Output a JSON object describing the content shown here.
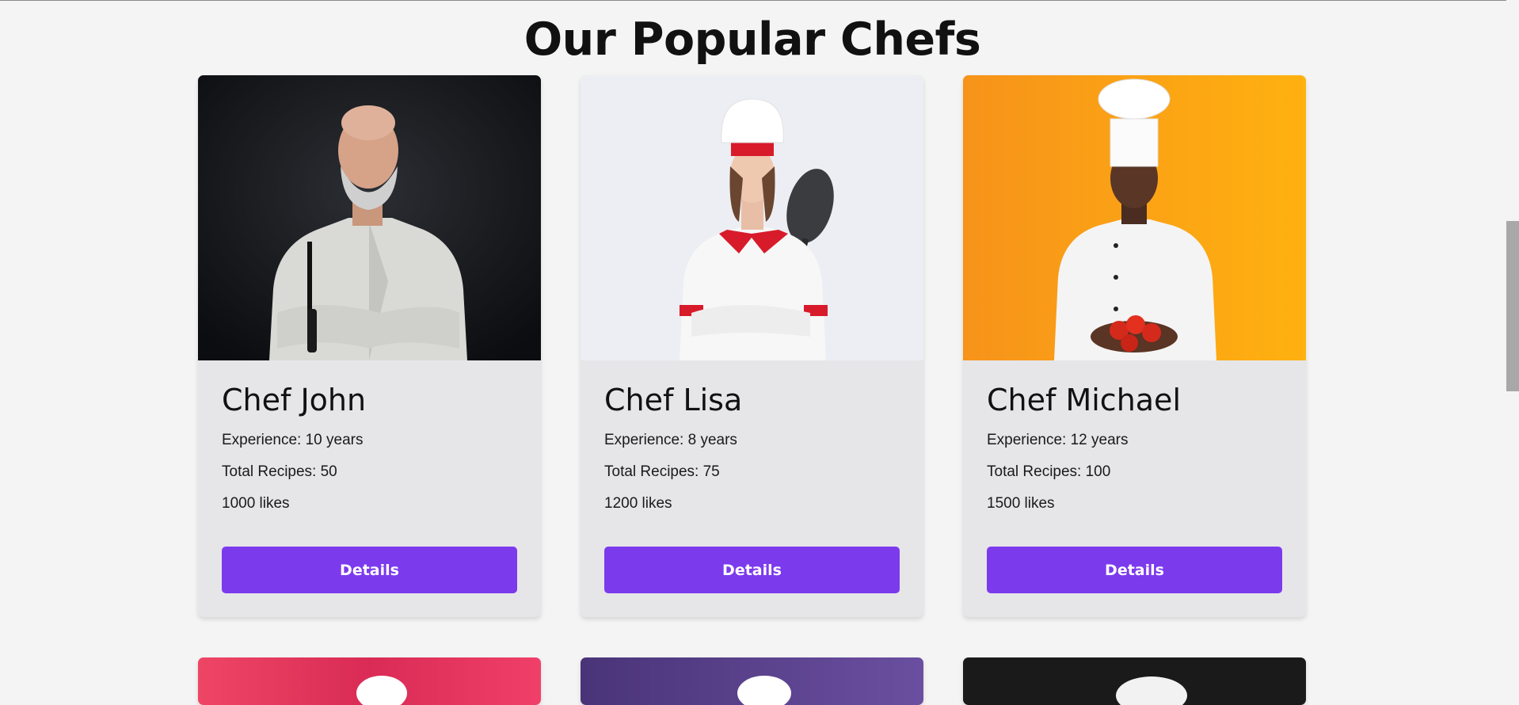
{
  "section": {
    "title": "Our Popular Chefs"
  },
  "chefs": [
    {
      "name": "Chef John",
      "experience": "Experience: 10 years",
      "recipes": "Total Recipes: 50",
      "likes": "1000 likes",
      "button": "Details",
      "photo_bg": "#15171c",
      "photo_desc": "bald-bearded-chef-portrait"
    },
    {
      "name": "Chef Lisa",
      "experience": "Experience: 8 years",
      "recipes": "Total Recipes: 75",
      "likes": "1200 likes",
      "button": "Details",
      "photo_bg": "#eceef3",
      "photo_desc": "female-chef-with-pan-portrait"
    },
    {
      "name": "Chef Michael",
      "experience": "Experience: 12 years",
      "recipes": "Total Recipes: 100",
      "likes": "1500 likes",
      "button": "Details",
      "photo_bg": "#f9a21b",
      "photo_desc": "chef-holding-tomatoes-portrait"
    }
  ],
  "chefs_row2": [
    {
      "photo_bg": "#e43b63",
      "photo_desc": "chef-portrait-red-background"
    },
    {
      "photo_bg": "#5b3f8c",
      "photo_desc": "chef-portrait-purple-background"
    },
    {
      "photo_bg": "#1b1b1b",
      "photo_desc": "chef-portrait-dark-background"
    }
  ],
  "colors": {
    "accent": "#7c3aed",
    "page_bg": "#f4f4f4",
    "card_bg": "#e6e6e9"
  }
}
